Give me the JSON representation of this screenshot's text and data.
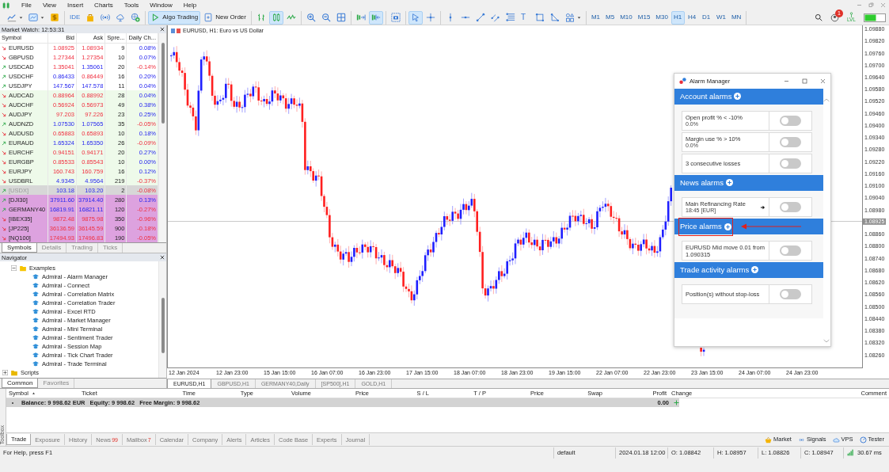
{
  "menu": [
    "File",
    "View",
    "Insert",
    "Charts",
    "Tools",
    "Window",
    "Help"
  ],
  "toolbar_groups": [
    [
      {
        "kind": "line-chart-menu",
        "selected": false
      },
      {
        "kind": "template-menu",
        "selected": false
      },
      {
        "kind": "dollar",
        "selected": false
      }
    ],
    [
      {
        "kind": "ide",
        "label": "IDE",
        "selected": false
      },
      {
        "kind": "bag",
        "selected": false
      },
      {
        "kind": "signal",
        "selected": false
      },
      {
        "kind": "cloud",
        "selected": false
      },
      {
        "kind": "globe-plus",
        "selected": false
      }
    ],
    [
      {
        "kind": "play",
        "label": "Algo Trading",
        "selected": true
      },
      {
        "kind": "order",
        "label": "New Order",
        "selected": false
      }
    ],
    [
      {
        "kind": "bars",
        "selected": false
      },
      {
        "kind": "candles",
        "selected": true
      },
      {
        "kind": "line",
        "selected": false
      }
    ],
    [
      {
        "kind": "zoom-in",
        "selected": false
      },
      {
        "kind": "zoom-out",
        "selected": false
      },
      {
        "kind": "grid",
        "selected": false
      }
    ],
    [
      {
        "kind": "autoscroll",
        "selected": false
      },
      {
        "kind": "shift",
        "selected": true
      }
    ],
    [
      {
        "kind": "screenshot",
        "selected": false
      }
    ],
    [
      {
        "kind": "cursor",
        "selected": true
      },
      {
        "kind": "crosshair",
        "selected": false
      }
    ],
    [
      {
        "kind": "vline",
        "selected": false
      },
      {
        "kind": "hline",
        "selected": false
      },
      {
        "kind": "trendline",
        "selected": false
      },
      {
        "kind": "channel",
        "selected": false
      },
      {
        "kind": "fibo",
        "selected": false
      },
      {
        "kind": "text",
        "label": "T",
        "selected": false
      },
      {
        "kind": "rect",
        "selected": false
      },
      {
        "kind": "angle",
        "selected": false
      },
      {
        "kind": "shapes-menu",
        "selected": false
      }
    ]
  ],
  "timeframes": [
    {
      "label": "M1",
      "selected": false
    },
    {
      "label": "M5",
      "selected": false
    },
    {
      "label": "M10",
      "selected": false
    },
    {
      "label": "M15",
      "selected": false
    },
    {
      "label": "M30",
      "selected": false
    },
    {
      "label": "H1",
      "selected": true
    },
    {
      "label": "H4",
      "selected": false
    },
    {
      "label": "D1",
      "selected": false
    },
    {
      "label": "W1",
      "selected": false
    },
    {
      "label": "MN",
      "selected": false
    }
  ],
  "notification_badge": "1",
  "level_label": "LVL",
  "market_watch": {
    "title": "Market Watch: 12:53:31",
    "columns": [
      "Symbol",
      "Bid",
      "Ask",
      "Spre...",
      "Daily Ch..."
    ],
    "rows": [
      {
        "kind": "major",
        "symbol": "EURUSD",
        "rising": false,
        "bid": "1.08925",
        "bid_rising": false,
        "ask": "1.08934",
        "ask_rising": false,
        "spread": "9",
        "change": "0.08%",
        "change_rising": true
      },
      {
        "kind": "major",
        "symbol": "GBPUSD",
        "rising": false,
        "bid": "1.27344",
        "bid_rising": false,
        "ask": "1.27354",
        "ask_rising": false,
        "spread": "10",
        "change": "0.07%",
        "change_rising": true
      },
      {
        "kind": "major",
        "symbol": "USDCAD",
        "rising": true,
        "bid": "1.35041",
        "bid_rising": false,
        "ask": "1.35061",
        "ask_rising": true,
        "spread": "20",
        "change": "-0.14%",
        "change_rising": false
      },
      {
        "kind": "major",
        "symbol": "USDCHF",
        "rising": true,
        "bid": "0.86433",
        "bid_rising": true,
        "ask": "0.86449",
        "ask_rising": false,
        "spread": "16",
        "change": "0.20%",
        "change_rising": true
      },
      {
        "kind": "major",
        "symbol": "USDJPY",
        "rising": true,
        "bid": "147.567",
        "bid_rising": true,
        "ask": "147.578",
        "ask_rising": true,
        "spread": "11",
        "change": "0.04%",
        "change_rising": true
      },
      {
        "kind": "cross",
        "symbol": "AUDCAD",
        "rising": false,
        "bid": "0.88964",
        "bid_rising": false,
        "ask": "0.88992",
        "ask_rising": false,
        "spread": "28",
        "change": "0.04%",
        "change_rising": true
      },
      {
        "kind": "cross",
        "symbol": "AUDCHF",
        "rising": false,
        "bid": "0.56924",
        "bid_rising": false,
        "ask": "0.56973",
        "ask_rising": false,
        "spread": "49",
        "change": "0.38%",
        "change_rising": true
      },
      {
        "kind": "cross",
        "symbol": "AUDJPY",
        "rising": false,
        "bid": "97.203",
        "bid_rising": false,
        "ask": "97.226",
        "ask_rising": false,
        "spread": "23",
        "change": "0.25%",
        "change_rising": true
      },
      {
        "kind": "cross",
        "symbol": "AUDNZD",
        "rising": true,
        "bid": "1.07530",
        "bid_rising": true,
        "ask": "1.07565",
        "ask_rising": true,
        "spread": "35",
        "change": "-0.05%",
        "change_rising": false
      },
      {
        "kind": "cross",
        "symbol": "AUDUSD",
        "rising": false,
        "bid": "0.65883",
        "bid_rising": false,
        "ask": "0.65893",
        "ask_rising": false,
        "spread": "10",
        "change": "0.18%",
        "change_rising": true
      },
      {
        "kind": "cross",
        "symbol": "EURAUD",
        "rising": true,
        "bid": "1.65324",
        "bid_rising": true,
        "ask": "1.65350",
        "ask_rising": true,
        "spread": "26",
        "change": "-0.09%",
        "change_rising": false
      },
      {
        "kind": "cross",
        "symbol": "EURCHF",
        "rising": false,
        "bid": "0.94151",
        "bid_rising": false,
        "ask": "0.94171",
        "ask_rising": false,
        "spread": "20",
        "change": "0.27%",
        "change_rising": true
      },
      {
        "kind": "cross",
        "symbol": "EURGBP",
        "rising": false,
        "bid": "0.85533",
        "bid_rising": false,
        "ask": "0.85543",
        "ask_rising": false,
        "spread": "10",
        "change": "0.00%",
        "change_rising": true
      },
      {
        "kind": "cross",
        "symbol": "EURJPY",
        "rising": false,
        "bid": "160.743",
        "bid_rising": false,
        "ask": "160.759",
        "ask_rising": false,
        "spread": "16",
        "change": "0.12%",
        "change_rising": true
      },
      {
        "kind": "cross",
        "symbol": "USDBRL",
        "rising": false,
        "bid": "4.9345",
        "bid_rising": true,
        "ask": "4.9564",
        "ask_rising": true,
        "spread": "219",
        "change": "-0.37%",
        "change_rising": false
      },
      {
        "kind": "disabled",
        "symbol": "[USDX]",
        "rising": true,
        "bid": "103.18",
        "bid_rising": true,
        "ask": "103.20",
        "ask_rising": true,
        "spread": "2",
        "change": "-0.08%",
        "change_rising": false
      },
      {
        "kind": "index",
        "symbol": "[DJI30]",
        "rising": true,
        "bid": "37911.60",
        "bid_rising": true,
        "ask": "37914.40",
        "ask_rising": true,
        "spread": "280",
        "change": "0.13%",
        "change_rising": true
      },
      {
        "kind": "index",
        "symbol": "GERMANY40",
        "rising": true,
        "bid": "16819.91",
        "bid_rising": true,
        "ask": "16821.11",
        "ask_rising": true,
        "spread": "120",
        "change": "-0.27%",
        "change_rising": false
      },
      {
        "kind": "index",
        "symbol": "[IBEX35]",
        "rising": false,
        "bid": "9872.48",
        "bid_rising": false,
        "ask": "9875.98",
        "ask_rising": false,
        "spread": "350",
        "change": "-0.96%",
        "change_rising": false
      },
      {
        "kind": "index",
        "symbol": "[JP225]",
        "rising": false,
        "bid": "36136.59",
        "bid_rising": false,
        "ask": "36145.59",
        "ask_rising": false,
        "spread": "900",
        "change": "-0.18%",
        "change_rising": false
      },
      {
        "kind": "index",
        "symbol": "[NQ100]",
        "rising": false,
        "bid": "17494.93",
        "bid_rising": false,
        "ask": "17496.83",
        "ask_rising": false,
        "spread": "190",
        "change": "-0.05%",
        "change_rising": false
      }
    ],
    "tabs": [
      {
        "label": "Symbols",
        "selected": true
      },
      {
        "label": "Details",
        "selected": false
      },
      {
        "label": "Trading",
        "selected": false
      },
      {
        "label": "Ticks",
        "selected": false
      }
    ]
  },
  "navigator": {
    "title": "Navigator",
    "tree": [
      {
        "kind": "folder",
        "label": "Examples",
        "expanded": true,
        "children": [
          {
            "kind": "program",
            "label": "Admiral - Alarm Manager"
          },
          {
            "kind": "program",
            "label": "Admiral - Connect"
          },
          {
            "kind": "program",
            "label": "Admiral - Correlation Matrix"
          },
          {
            "kind": "program",
            "label": "Admiral - Correlation Trader"
          },
          {
            "kind": "program",
            "label": "Admiral - Excel RTD"
          },
          {
            "kind": "program",
            "label": "Admiral - Market Manager"
          },
          {
            "kind": "program",
            "label": "Admiral - Mini Terminal"
          },
          {
            "kind": "program",
            "label": "Admiral - Sentiment Trader"
          },
          {
            "kind": "program",
            "label": "Admiral - Session Map"
          },
          {
            "kind": "program",
            "label": "Admiral - Tick Chart Trader"
          },
          {
            "kind": "program",
            "label": "Admiral - Trade Terminal"
          }
        ]
      },
      {
        "kind": "folder-root",
        "label": "Scripts",
        "expanded": false
      }
    ],
    "tabs": [
      {
        "label": "Common",
        "selected": true
      },
      {
        "label": "Favorites",
        "selected": false
      }
    ]
  },
  "chart": {
    "title": "EURUSD, H1:  Euro vs US Dollar",
    "current_price": "1.08925",
    "price_labels": [
      "1.09880",
      "1.09820",
      "1.09760",
      "1.09700",
      "1.09640",
      "1.09580",
      "1.09520",
      "1.09460",
      "1.09400",
      "1.09340",
      "1.09280",
      "1.09220",
      "1.09160",
      "1.09100",
      "1.09040",
      "1.08980",
      "1.08860",
      "1.08800",
      "1.08740",
      "1.08680",
      "1.08620",
      "1.08560",
      "1.08500",
      "1.08440",
      "1.08380",
      "1.08320",
      "1.08260"
    ],
    "time_labels": [
      "12 Jan 2024",
      "12 Jan 23:00",
      "15 Jan 15:00",
      "16 Jan 07:00",
      "16 Jan 23:00",
      "17 Jan 15:00",
      "18 Jan 07:00",
      "18 Jan 23:00",
      "19 Jan 15:00",
      "22 Jan 07:00",
      "22 Jan 23:00",
      "23 Jan 15:00",
      "24 Jan 07:00",
      "24 Jan 23:00"
    ],
    "tabs": [
      {
        "label": "EURUSD,H1",
        "selected": true
      },
      {
        "label": "GBPUSD,H1",
        "selected": false
      },
      {
        "label": "GERMANY40,Daily",
        "selected": false
      },
      {
        "label": "[SP500],H1",
        "selected": false
      },
      {
        "label": "GOLD,H1",
        "selected": false
      }
    ]
  },
  "alarm_manager": {
    "title": "Alarm Manager",
    "sections": [
      {
        "title": "Account alarms",
        "highlighted": false,
        "alarms": [
          {
            "kind": "plain",
            "title": "Open profit % < -10%",
            "detail": "0.0%",
            "on": false
          },
          {
            "kind": "plain",
            "title": "Margin use % > 10%",
            "detail": "0.0%",
            "on": false
          },
          {
            "kind": "plain",
            "title": "3 consecutive losses",
            "on": false
          }
        ]
      },
      {
        "title": "News alarms",
        "highlighted": false,
        "alarms": [
          {
            "kind": "event",
            "title": "Main Refinancing Rate",
            "detail": "18:45 [EUR]",
            "on": false
          }
        ]
      },
      {
        "title": "Price alarms",
        "highlighted": true,
        "alarms": [
          {
            "kind": "plain",
            "title": "EURUSD Mid move 0.01 from 1.090315",
            "on": false
          }
        ]
      },
      {
        "title": "Trade activity alarms",
        "highlighted": false,
        "alarms": [
          {
            "kind": "plain",
            "title": "Position(s) without stop-loss",
            "on": false
          }
        ]
      }
    ]
  },
  "trade": {
    "columns": [
      {
        "label": "Symbol",
        "sorted": true
      },
      {
        "label": "Ticket",
        "sorted": false
      },
      {
        "label": "Time",
        "sorted": false
      },
      {
        "label": "Type",
        "sorted": false
      },
      {
        "label": "Volume",
        "sorted": false
      },
      {
        "label": "Price",
        "sorted": false
      },
      {
        "label": "S / L",
        "sorted": false
      },
      {
        "label": "T / P",
        "sorted": false
      },
      {
        "label": "Price",
        "sorted": false
      },
      {
        "label": "Swap",
        "sorted": false
      },
      {
        "label": "Profit",
        "sorted": false
      },
      {
        "label": "Change",
        "sorted": false
      },
      {
        "label": "Comment",
        "sorted": false
      }
    ],
    "balance": "Balance: 9 998.62 EUR",
    "equity": "Equity: 9 998.62",
    "free_margin": "Free Margin: 9 998.62",
    "profit": "0.00"
  },
  "toolbox_label": "Toolbox",
  "bottom_tabs": [
    {
      "label": "Trade",
      "selected": true
    },
    {
      "label": "Exposure",
      "selected": false
    },
    {
      "label": "History",
      "selected": false
    },
    {
      "label": "News",
      "badge": "99",
      "selected": false
    },
    {
      "label": "Mailbox",
      "badge": "7",
      "selected": false
    },
    {
      "label": "Calendar",
      "selected": false
    },
    {
      "label": "Company",
      "selected": false
    },
    {
      "label": "Alerts",
      "selected": false
    },
    {
      "label": "Articles",
      "selected": false
    },
    {
      "label": "Code Base",
      "selected": false
    },
    {
      "label": "Experts",
      "selected": false
    },
    {
      "label": "Journal",
      "selected": false
    }
  ],
  "services": [
    {
      "kind": "market",
      "label": "Market"
    },
    {
      "kind": "signals",
      "label": "Signals"
    },
    {
      "kind": "vps",
      "label": "VPS"
    },
    {
      "kind": "tester",
      "label": "Tester"
    }
  ],
  "status_bar": {
    "help": "For Help, press F1",
    "profile": "default",
    "time": "2024.01.18 12:00",
    "open": "O: 1.08842",
    "high": "H: 1.08957",
    "low": "L: 1.08826",
    "close": "C: 1.08947",
    "ping": "30.67 ms"
  }
}
